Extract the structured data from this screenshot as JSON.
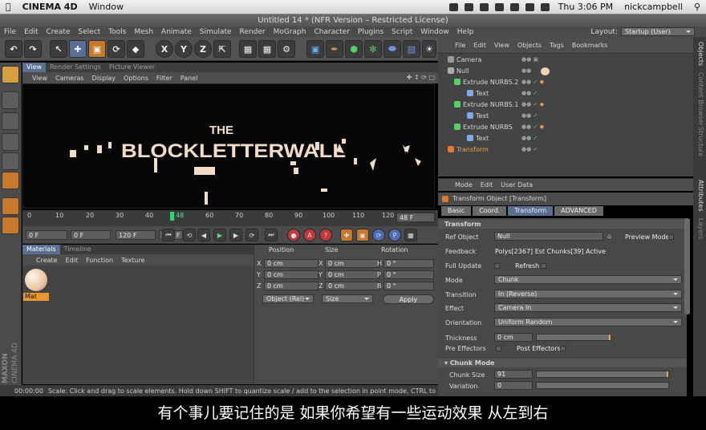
{
  "mac": {
    "apple_icon": "apple-icon",
    "app_name": "CINEMA 4D",
    "menu": [
      "Window"
    ],
    "clock": "Thu 3:06 PM",
    "user": "nickcampbell"
  },
  "window_title": "Untitled 14 * (NFR Version – Restricted License)",
  "menubar": [
    "File",
    "Edit",
    "Create",
    "Select",
    "Tools",
    "Mesh",
    "Animate",
    "Simulate",
    "Render",
    "MoGraph",
    "Character",
    "Plugins",
    "Script",
    "Window",
    "Help"
  ],
  "layout": {
    "label": "Layout:",
    "value": "Startup (User)"
  },
  "viewport": {
    "tabs": [
      "View",
      "Render Settings",
      "Picture Viewer"
    ],
    "menu": [
      "View",
      "Cameras",
      "Display",
      "Options",
      "Filter",
      "Panel"
    ],
    "text_small": "THE",
    "text_big": "BLOCKLETTERWALL"
  },
  "timeline": {
    "ticks": [
      "0",
      "10",
      "20",
      "30",
      "40",
      "48",
      "60",
      "70",
      "80",
      "90",
      "100",
      "110",
      "120"
    ],
    "current_frame": "48 F"
  },
  "transport": {
    "start": "0 F",
    "min": "0 F",
    "end": "120 F",
    "max": "120 F"
  },
  "materials": {
    "tabs": [
      "Materials",
      "Timeline"
    ],
    "menu": [
      "Create",
      "Edit",
      "Function",
      "Texture"
    ],
    "items": [
      {
        "label": "Mat"
      }
    ]
  },
  "coords": {
    "headers": [
      "Position",
      "Size",
      "Rotation"
    ],
    "rows": [
      {
        "axis": "X",
        "pos": "0 cm",
        "size_axis": "X",
        "size": "0 cm",
        "rot_axis": "H",
        "rot": "0 °"
      },
      {
        "axis": "Y",
        "pos": "0 cm",
        "size_axis": "Y",
        "size": "0 cm",
        "rot_axis": "P",
        "rot": "0 °"
      },
      {
        "axis": "Z",
        "pos": "0 cm",
        "size_axis": "Z",
        "size": "0 cm",
        "rot_axis": "B",
        "rot": "0 °"
      }
    ],
    "mode": "Object (Rel)",
    "size_mode": "Size",
    "apply": "Apply"
  },
  "status": {
    "time": "00:00:00",
    "message": "Scale: Click and drag to scale elements. Hold down SHIFT to quantize scale / add to the selection in point mode, CTRL to remove."
  },
  "objects": {
    "menu": [
      "File",
      "Edit",
      "View",
      "Objects",
      "Tags",
      "Bookmarks"
    ],
    "tree": [
      {
        "name": "Camera",
        "depth": 0
      },
      {
        "name": "Null",
        "depth": 0
      },
      {
        "name": "Extrude NURBS.2",
        "depth": 1
      },
      {
        "name": "Text",
        "depth": 2
      },
      {
        "name": "Extrude NURBS.1",
        "depth": 1
      },
      {
        "name": "Text",
        "depth": 2
      },
      {
        "name": "Extrude NURBS",
        "depth": 1
      },
      {
        "name": "Text",
        "depth": 2
      },
      {
        "name": "Transform",
        "depth": 0
      }
    ]
  },
  "side_tabs": [
    "Objects",
    "Content Browser",
    "Structure",
    "Attributes",
    "Layers"
  ],
  "attributes": {
    "menu": [
      "Mode",
      "Edit",
      "User Data"
    ],
    "title": "Transform Object [Transform]",
    "tabs": [
      "Basic",
      "Coord.",
      "Transform",
      "ADVANCED"
    ],
    "section": "Transform",
    "ref_object_label": "Ref Object",
    "ref_object_value": "Null",
    "preview_mode": "Preview Mode",
    "feedback_label": "Feedback",
    "feedback_value": "Polys[2367] Est Chunks[39]  Active",
    "full_update": "Full Update",
    "refresh": "Refresh",
    "mode_label": "Mode",
    "mode_value": "Chunk",
    "transition_label": "Transition",
    "transition_value": "In  (Reverse)",
    "effect_label": "Effect",
    "effect_value": "Camera In",
    "orientation_label": "Orientation",
    "orientation_value": "Uniform Random",
    "thickness_label": "Thickness",
    "thickness_value": "0 cm",
    "pre_effectors": "Pre Effectors",
    "post_effectors": "Post Effectors",
    "chunk_section": "Chunk Mode",
    "chunk_size_label": "Chunk Size",
    "chunk_size_value": "91",
    "variation_label": "Variation",
    "variation_value": "0"
  },
  "subtitle": "有个事儿要记住的是  如果你希望有一些运动效果  从左到右"
}
